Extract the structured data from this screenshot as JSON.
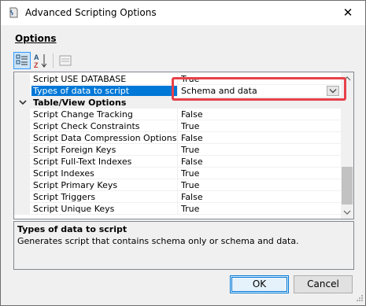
{
  "window": {
    "title": "Advanced Scripting Options",
    "icon": "scripting-options-icon",
    "close_glyph": "✕"
  },
  "section_label": "Options",
  "toolbar": {
    "buttons": [
      "categorized-icon",
      "alphabetical-icon",
      "property-pages-icon"
    ]
  },
  "grid": {
    "rows": [
      {
        "name": "Script USE DATABASE",
        "value": "True",
        "kind": "prop"
      },
      {
        "name": "Types of data to script",
        "value": "Schema and data",
        "kind": "prop",
        "selected": true
      },
      {
        "name": "Table/View Options",
        "value": "",
        "kind": "category",
        "expanded": true
      },
      {
        "name": "Script Change Tracking",
        "value": "False",
        "kind": "prop"
      },
      {
        "name": "Script Check Constraints",
        "value": "True",
        "kind": "prop"
      },
      {
        "name": "Script Data Compression Options",
        "value": "False",
        "kind": "prop"
      },
      {
        "name": "Script Foreign Keys",
        "value": "True",
        "kind": "prop"
      },
      {
        "name": "Script Full-Text Indexes",
        "value": "False",
        "kind": "prop"
      },
      {
        "name": "Script Indexes",
        "value": "True",
        "kind": "prop"
      },
      {
        "name": "Script Primary Keys",
        "value": "True",
        "kind": "prop"
      },
      {
        "name": "Script Triggers",
        "value": "False",
        "kind": "prop"
      },
      {
        "name": "Script Unique Keys",
        "value": "True",
        "kind": "prop"
      }
    ]
  },
  "description": {
    "title": "Types of data to script",
    "text": "Generates script that contains schema only or schema and data."
  },
  "buttons": {
    "ok": "OK",
    "cancel": "Cancel"
  },
  "colors": {
    "selection": "#0078d7",
    "highlight_box": "#e8404a"
  }
}
